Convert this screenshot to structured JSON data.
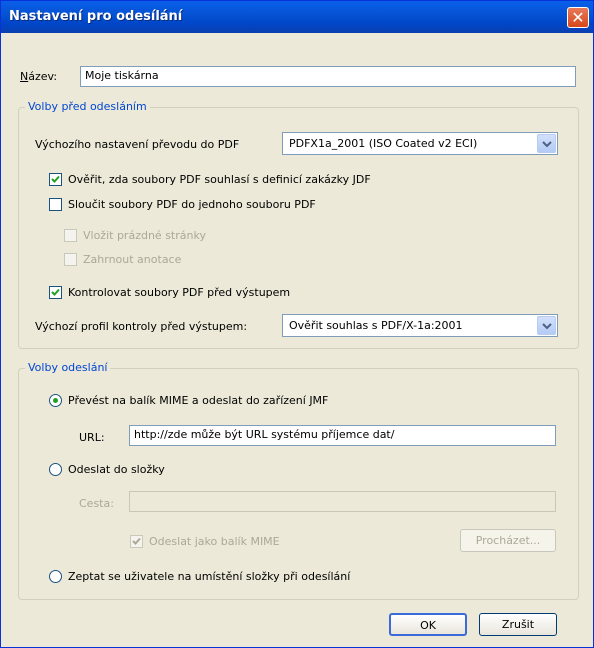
{
  "window": {
    "title": "Nastavení pro odesílání",
    "close_symbol": "✕"
  },
  "name": {
    "label_prefix": "N",
    "label_rest": "ázev:",
    "value": "Moje tiskárna"
  },
  "prefs": {
    "legend": "Volby před odesláním",
    "conversion_label": "Výchozího nastavení převodu do PDF",
    "conversion_value": "PDFX1a_2001 (ISO Coated v2 ECI)",
    "verify_label": "Ověřit, zda soubory PDF souhlasí s definicí zakázky JDF",
    "verify_checked": true,
    "merge_label": "Sloučit soubory PDF do jednoho souboru PDF",
    "merge_checked": false,
    "insert_blank_label": "Vložit prázdné stránky",
    "include_annotations_label": "Zahrnout anotace",
    "preflight_label": "Kontrolovat soubory PDF před výstupem",
    "preflight_checked": true,
    "profile_label": "Výchozí profil kontroly před výstupem:",
    "profile_value": "Ověřit souhlas s PDF/X-1a:2001"
  },
  "send": {
    "legend": "Volby odeslání",
    "mime_label": "Převést na balík MIME a odeslat do zařízení JMF",
    "url_label": "URL:",
    "url_value": "http://zde může být URL systému příjemce dat/",
    "folder_label": "Odeslat do složky",
    "path_label": "Cesta:",
    "path_value": "",
    "send_as_mime_label": "Odeslat jako balík MIME",
    "browse_label": "Procházet...",
    "ask_label": "Zeptat se uživatele na umístění složky při odesílání",
    "selected": "mime"
  },
  "footer": {
    "ok_label": "OK",
    "cancel_label": "Zrušit"
  }
}
